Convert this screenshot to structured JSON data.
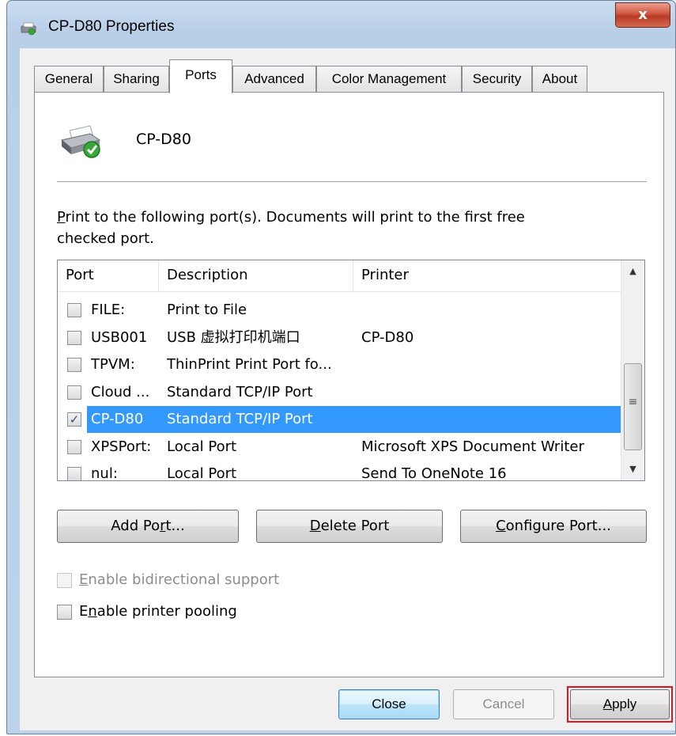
{
  "window": {
    "title": "CP-D80 Properties",
    "close_label": "x"
  },
  "tabs": [
    {
      "label": "General"
    },
    {
      "label": "Sharing"
    },
    {
      "label": "Ports"
    },
    {
      "label": "Advanced"
    },
    {
      "label": "Color Management"
    },
    {
      "label": "Security"
    },
    {
      "label": "About"
    }
  ],
  "active_tab": "Ports",
  "printer": {
    "name": "CP-D80",
    "icon": "printer-ready-icon"
  },
  "instructions": {
    "accel": "P",
    "rest": "rint to the following port(s). Documents will print to the first free checked port."
  },
  "port_list": {
    "headers": {
      "port": "Port",
      "description": "Description",
      "printer": "Printer"
    },
    "rows": [
      {
        "port": "FILE:",
        "description": "Print to File",
        "printer": "",
        "checked": false,
        "selected": false
      },
      {
        "port": "USB001",
        "description": "USB 虚拟打印机端口",
        "printer": "CP-D80",
        "checked": false,
        "selected": false
      },
      {
        "port": "TPVM:",
        "description": "ThinPrint Print Port fo...",
        "printer": "",
        "checked": false,
        "selected": false
      },
      {
        "port": "Cloud ...",
        "description": "Standard TCP/IP Port",
        "printer": "",
        "checked": false,
        "selected": false
      },
      {
        "port": "CP-D80",
        "description": "Standard TCP/IP Port",
        "printer": "",
        "checked": true,
        "selected": true
      },
      {
        "port": "XPSPort:",
        "description": "Local Port",
        "printer": "Microsoft XPS Document Writer",
        "checked": false,
        "selected": false
      },
      {
        "port": "nul:",
        "description": "Local Port",
        "printer": "Send To OneNote 16",
        "checked": false,
        "selected": false
      }
    ],
    "scroll_up": "▲",
    "scroll_down": "▼",
    "scroll_grip": "≡"
  },
  "buttons": {
    "add_port": {
      "pre": "Add Po",
      "accel": "r",
      "post": "t..."
    },
    "delete_port": {
      "pre": "",
      "accel": "D",
      "post": "elete Port"
    },
    "configure_port": {
      "pre": "",
      "accel": "C",
      "post": "onfigure Port..."
    }
  },
  "options": {
    "bidirectional": {
      "pre": "",
      "accel": "E",
      "post": "nable bidirectional support",
      "checked": false,
      "disabled": true
    },
    "pooling": {
      "pre": "E",
      "accel": "n",
      "post": "able printer pooling",
      "checked": false,
      "disabled": false
    }
  },
  "footer": {
    "close": "Close",
    "cancel": "Cancel",
    "apply_accel": "A",
    "apply_rest": "pply"
  },
  "colors": {
    "selection": "#3399ff",
    "highlight_box": "#e8141c"
  }
}
